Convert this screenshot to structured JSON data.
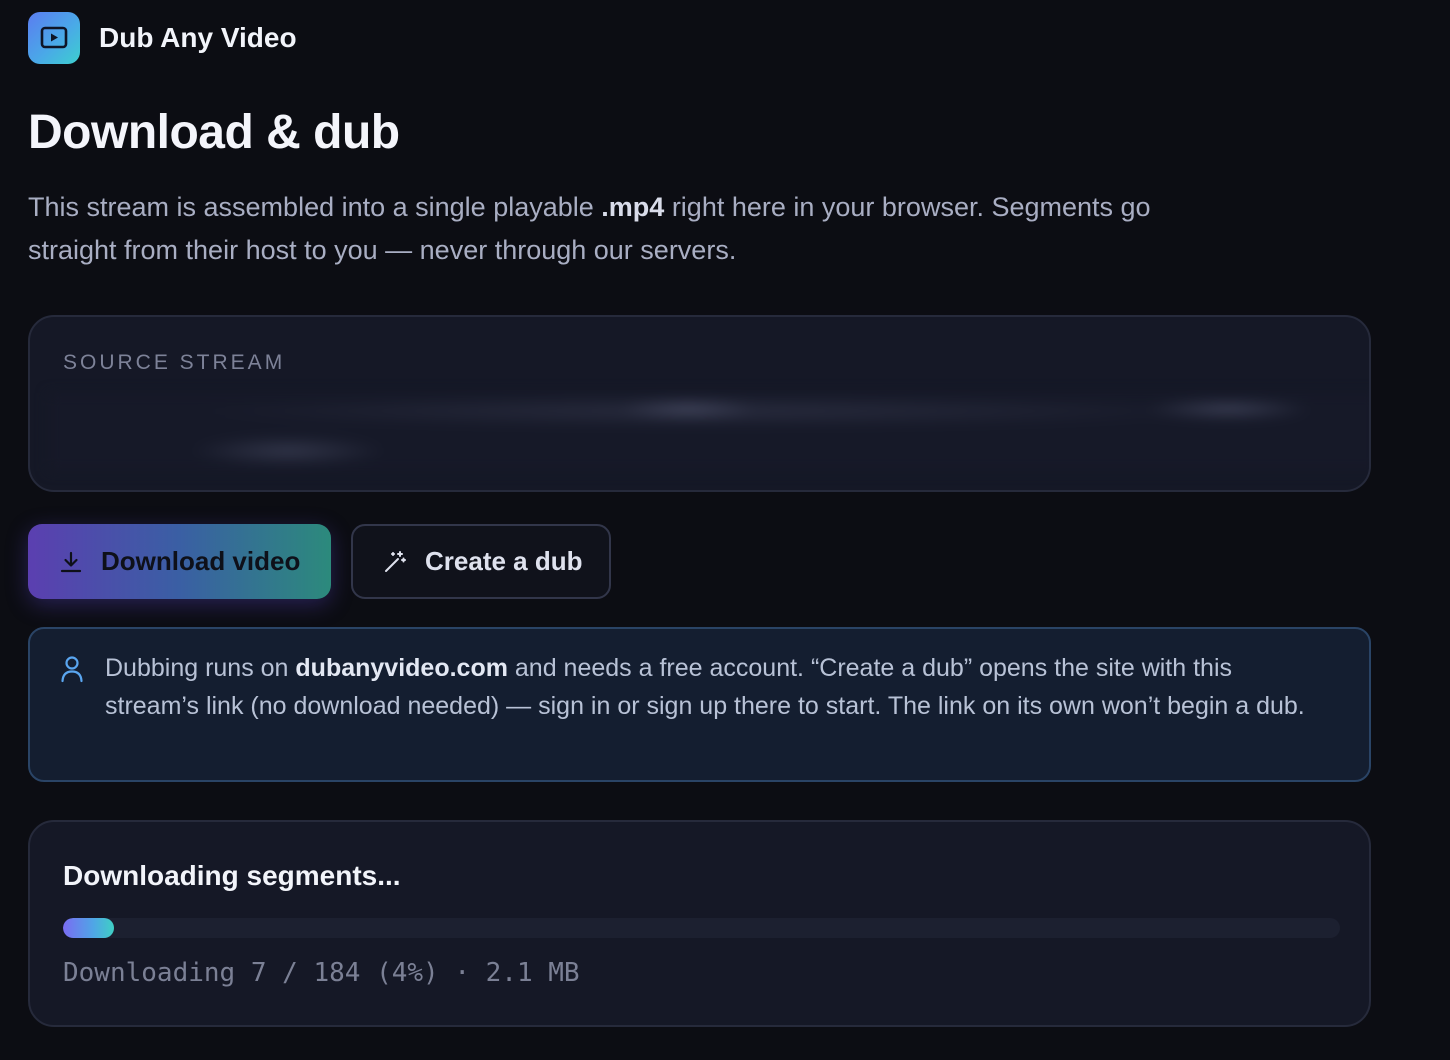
{
  "app": {
    "name": "Dub Any Video",
    "logo_icon": "play-screen-icon",
    "brand_gradient": [
      "#5b7cf0",
      "#3dcfcf"
    ]
  },
  "page": {
    "title": "Download & dub",
    "lead_part1": "This stream is assembled into a single playable ",
    "lead_bold": ".mp4",
    "lead_part2": " right here in your browser. Segments go straight from their host to you — never through our servers."
  },
  "source": {
    "label": "SOURCE STREAM"
  },
  "actions": {
    "download_label": "Download video",
    "download_icon": "download-icon",
    "dub_label": "Create a dub",
    "dub_icon": "magic-wand-icon"
  },
  "info": {
    "icon": "user-icon",
    "text_part1": "Dubbing runs on ",
    "text_bold": "dubanyvideo.com",
    "text_part2": " and needs a free account. “Create a dub” opens the site with this stream’s link (no download needed) — sign in or sign up there to start. The link on its own won’t begin a dub."
  },
  "progress": {
    "title": "Downloading segments...",
    "status": "Downloading 7 / 184 (4%) · 2.1 MB",
    "percent": 4,
    "fill_colors": [
      "#7a6cf2",
      "#3fd0c4"
    ]
  }
}
